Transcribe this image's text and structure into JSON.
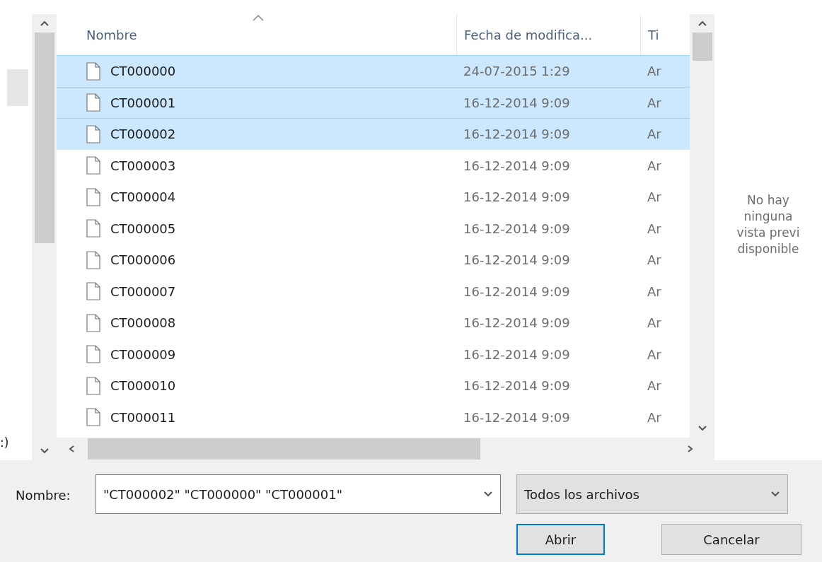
{
  "nav_pane": {
    "drive_label": ":)"
  },
  "file_list": {
    "columns": [
      {
        "label": "Nombre",
        "sorted": true
      },
      {
        "label": "Fecha de modifica...",
        "sorted": false
      },
      {
        "label": "Ti",
        "sorted": false
      }
    ],
    "rows": [
      {
        "name": "CT000000",
        "date": "24-07-2015 1:29",
        "type": "Ar",
        "selected": true
      },
      {
        "name": "CT000001",
        "date": "16-12-2014 9:09",
        "type": "Ar",
        "selected": true
      },
      {
        "name": "CT000002",
        "date": "16-12-2014 9:09",
        "type": "Ar",
        "selected": true
      },
      {
        "name": "CT000003",
        "date": "16-12-2014 9:09",
        "type": "Ar",
        "selected": false
      },
      {
        "name": "CT000004",
        "date": "16-12-2014 9:09",
        "type": "Ar",
        "selected": false
      },
      {
        "name": "CT000005",
        "date": "16-12-2014 9:09",
        "type": "Ar",
        "selected": false
      },
      {
        "name": "CT000006",
        "date": "16-12-2014 9:09",
        "type": "Ar",
        "selected": false
      },
      {
        "name": "CT000007",
        "date": "16-12-2014 9:09",
        "type": "Ar",
        "selected": false
      },
      {
        "name": "CT000008",
        "date": "16-12-2014 9:09",
        "type": "Ar",
        "selected": false
      },
      {
        "name": "CT000009",
        "date": "16-12-2014 9:09",
        "type": "Ar",
        "selected": false
      },
      {
        "name": "CT000010",
        "date": "16-12-2014 9:09",
        "type": "Ar",
        "selected": false
      },
      {
        "name": "CT000011",
        "date": "16-12-2014 9:09",
        "type": "Ar",
        "selected": false
      }
    ]
  },
  "preview": {
    "message_lines": [
      "No hay",
      "ninguna",
      "vista previ",
      "disponible"
    ]
  },
  "file_name": {
    "label": "Nombre:",
    "value": "\"CT000002\" \"CT000000\" \"CT000001\""
  },
  "file_type": {
    "value": "Todos los archivos"
  },
  "buttons": [
    {
      "label": "Abrir",
      "default": true
    },
    {
      "label": "Cancelar",
      "default": false
    }
  ]
}
